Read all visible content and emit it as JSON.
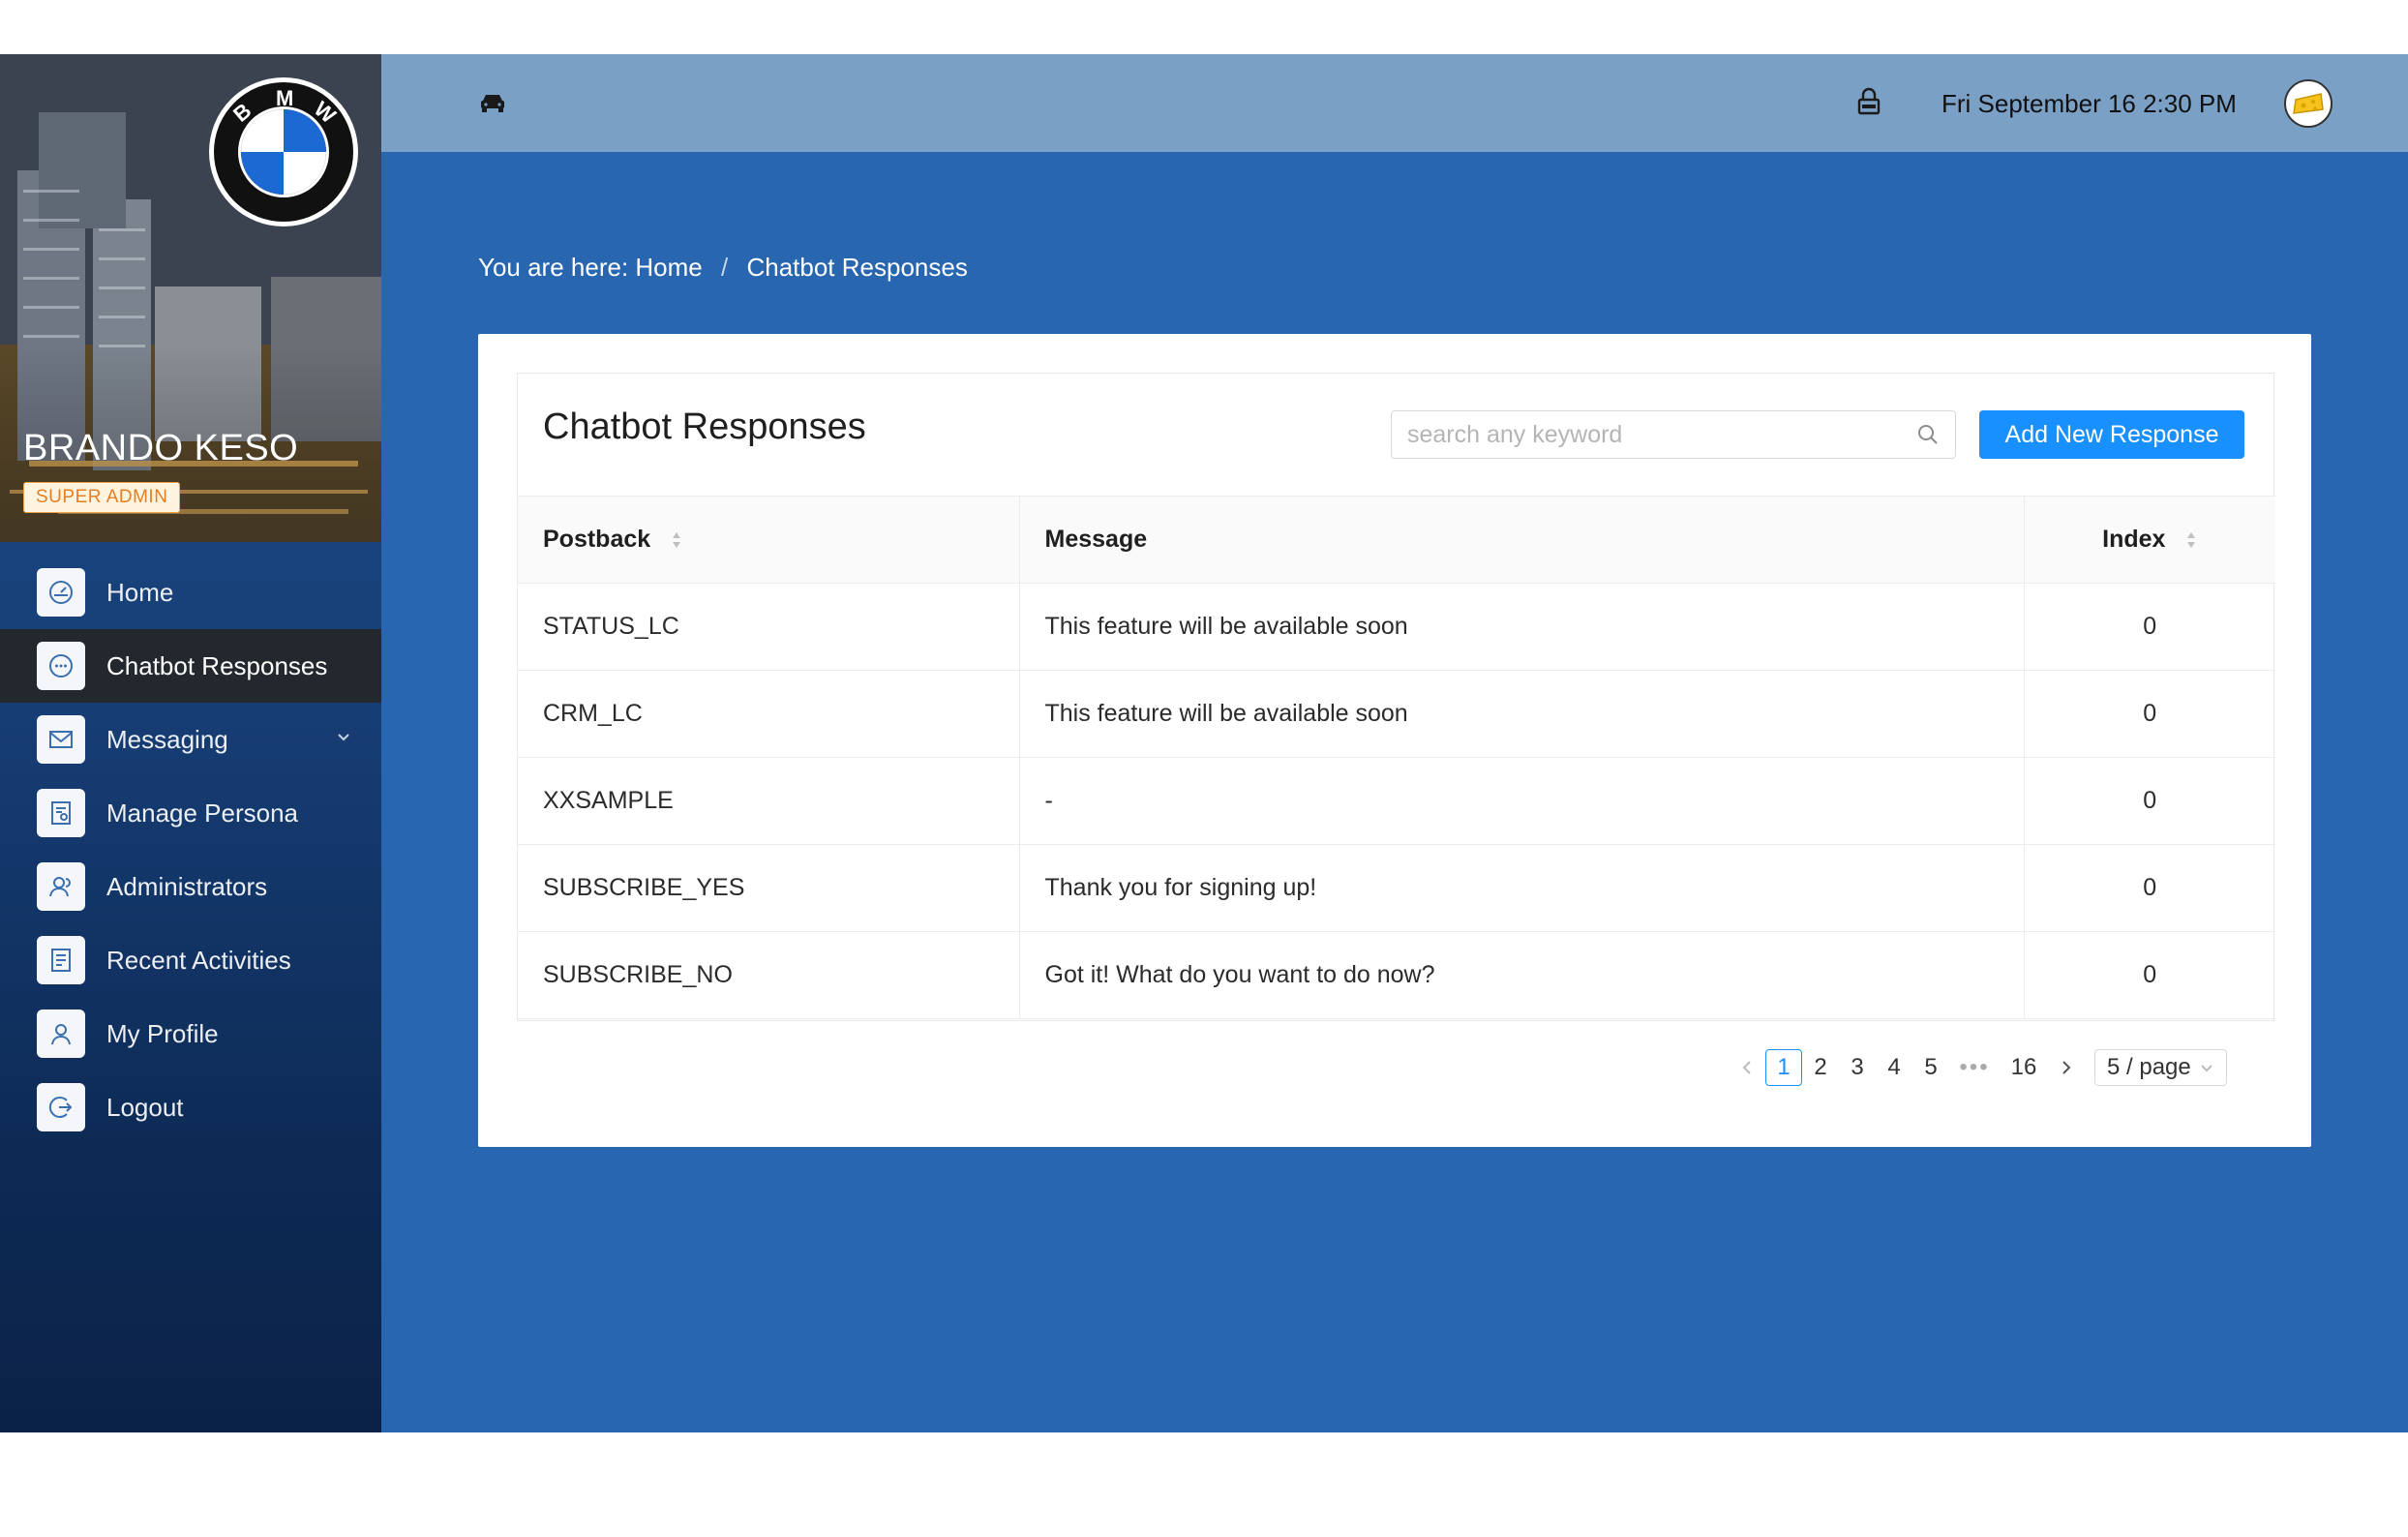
{
  "sidebar": {
    "user_name": "BRANDO KESO",
    "role": "SUPER ADMIN",
    "logo_letters": [
      "B",
      "M",
      "W"
    ],
    "items": [
      {
        "label": "Home",
        "icon": "dashboard-icon"
      },
      {
        "label": "Chatbot Responses",
        "icon": "chat-icon",
        "active": true
      },
      {
        "label": "Messaging",
        "icon": "mail-icon",
        "has_submenu": true
      },
      {
        "label": "Manage Persona",
        "icon": "persona-icon"
      },
      {
        "label": "Administrators",
        "icon": "users-icon"
      },
      {
        "label": "Recent Activities",
        "icon": "activity-icon"
      },
      {
        "label": "My Profile",
        "icon": "profile-icon"
      },
      {
        "label": "Logout",
        "icon": "logout-icon"
      }
    ]
  },
  "header": {
    "datetime": "Fri September 16 2:30 PM"
  },
  "breadcrumb": {
    "prefix": "You are here:",
    "home": "Home",
    "separator": "/",
    "current": "Chatbot Responses"
  },
  "card": {
    "title": "Chatbot Responses",
    "search_placeholder": "search any keyword",
    "add_button": "Add New Response"
  },
  "table": {
    "columns": [
      "Postback",
      "Message",
      "Index"
    ],
    "rows": [
      {
        "postback": "STATUS_LC",
        "message": "This feature will be available soon",
        "index": "0"
      },
      {
        "postback": "CRM_LC",
        "message": "This feature will be available soon",
        "index": "0"
      },
      {
        "postback": "XXSAMPLE",
        "message": "-",
        "index": "0"
      },
      {
        "postback": "SUBSCRIBE_YES",
        "message": "Thank you for signing up!",
        "index": "0"
      },
      {
        "postback": "SUBSCRIBE_NO",
        "message": "Got it! What do you want to do now?",
        "index": "0"
      }
    ]
  },
  "pagination": {
    "pages": [
      "1",
      "2",
      "3",
      "4",
      "5"
    ],
    "ellipsis": "•••",
    "last": "16",
    "current": "1",
    "page_size": "5 / page"
  },
  "colors": {
    "accent": "#1890ff",
    "main_bg": "#2866b0",
    "header_bg": "#7ba0c6",
    "active_nav": "#23272e"
  }
}
